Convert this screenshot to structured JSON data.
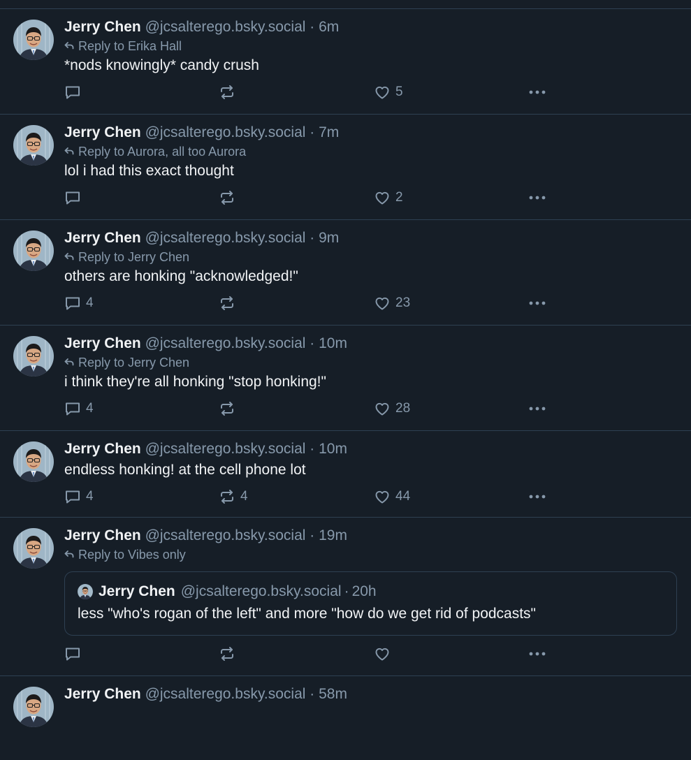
{
  "colors": {
    "background": "#161e27",
    "divider": "#2e4052",
    "text": "#f1f3f5",
    "muted": "#8799ab"
  },
  "icons": {
    "reply_indicator": "reply-arrow-icon",
    "comment": "speech-bubble-icon",
    "repost": "repost-arrows-icon",
    "like": "heart-icon",
    "more": "ellipsis-icon"
  },
  "posts": [
    {
      "name": "Jerry Chen",
      "handle": "@jcsalterego.bsky.social",
      "separator": "·",
      "time": "6m",
      "reply_to": "Reply to Erika Hall",
      "text": "*nods knowingly* candy crush",
      "comments": "",
      "reposts": "",
      "likes": "5"
    },
    {
      "name": "Jerry Chen",
      "handle": "@jcsalterego.bsky.social",
      "separator": "·",
      "time": "7m",
      "reply_to": "Reply to Aurora, all too Aurora",
      "text": "lol i had this exact thought",
      "comments": "",
      "reposts": "",
      "likes": "2"
    },
    {
      "name": "Jerry Chen",
      "handle": "@jcsalterego.bsky.social",
      "separator": "·",
      "time": "9m",
      "reply_to": "Reply to Jerry Chen",
      "text": "others are honking \"acknowledged!\"",
      "comments": "4",
      "reposts": "",
      "likes": "23"
    },
    {
      "name": "Jerry Chen",
      "handle": "@jcsalterego.bsky.social",
      "separator": "·",
      "time": "10m",
      "reply_to": "Reply to Jerry Chen",
      "text": "i think they're all honking \"stop honking!\"",
      "comments": "4",
      "reposts": "",
      "likes": "28"
    },
    {
      "name": "Jerry Chen",
      "handle": "@jcsalterego.bsky.social",
      "separator": "·",
      "time": "10m",
      "reply_to": "",
      "text": "endless honking! at the cell phone lot",
      "comments": "4",
      "reposts": "4",
      "likes": "44"
    },
    {
      "name": "Jerry Chen",
      "handle": "@jcsalterego.bsky.social",
      "separator": "·",
      "time": "19m",
      "reply_to": "Reply to Vibes only",
      "text": "",
      "comments": "",
      "reposts": "",
      "likes": "",
      "quote": {
        "name": "Jerry Chen",
        "handle": "@jcsalterego.bsky.social",
        "separator": "·",
        "time": "20h",
        "text": "less \"who's rogan of the left\" and more \"how do we get rid of podcasts\""
      }
    },
    {
      "name": "Jerry Chen",
      "handle": "@jcsalterego.bsky.social",
      "separator": "·",
      "time": "58m"
    }
  ]
}
